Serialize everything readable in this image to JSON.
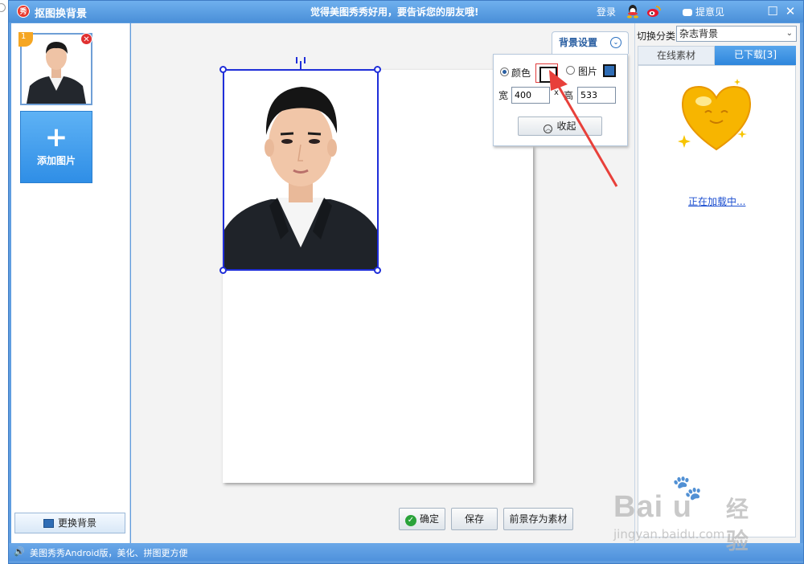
{
  "titlebar": {
    "app_logo_text": "秀",
    "title": "抠图换背景",
    "slogan": "觉得美图秀秀好用，要告诉您的朋友哦!",
    "login": "登录",
    "feedback": "提意见",
    "maximize": "☐",
    "close": "✕"
  },
  "left_panel": {
    "thumb_badge": "1",
    "thumb_close": "✕",
    "add_plus": "+",
    "add_label": "添加图片",
    "change_bg": "更换背景"
  },
  "bg_settings": {
    "tab_label": "背景设置",
    "tab_chevron": "⌄",
    "color_label": "颜色",
    "image_label": "图片",
    "width_label": "宽",
    "width_value": "400",
    "times": "x",
    "height_label": "高",
    "height_value": "533",
    "collapse_label": "收起",
    "collapse_icon": "︿",
    "color_selected": true,
    "swatch_color": "#ffffff"
  },
  "actions": {
    "confirm": "确定",
    "confirm_icon": "✓",
    "save": "保存",
    "save_foreground": "前景存为素材"
  },
  "right_panel": {
    "switch_label": "切换分类",
    "category": "杂志背景",
    "category_arrow": "⌄",
    "tab_online": "在线素材",
    "tab_downloaded": "已下载[3]",
    "loading": "正在加载中..."
  },
  "statusbar": {
    "speaker_icon": "🔊",
    "text": "美图秀秀Android版，美化、拼图更方便"
  },
  "watermark": {
    "brand": "Bai  u",
    "brand_cn": "经验",
    "url": "jingyan.baidu.com"
  },
  "colors": {
    "accent": "#4a8fd8",
    "selection": "#1f2ed9",
    "arrow": "#e8403a",
    "heart": "#f7b500"
  }
}
